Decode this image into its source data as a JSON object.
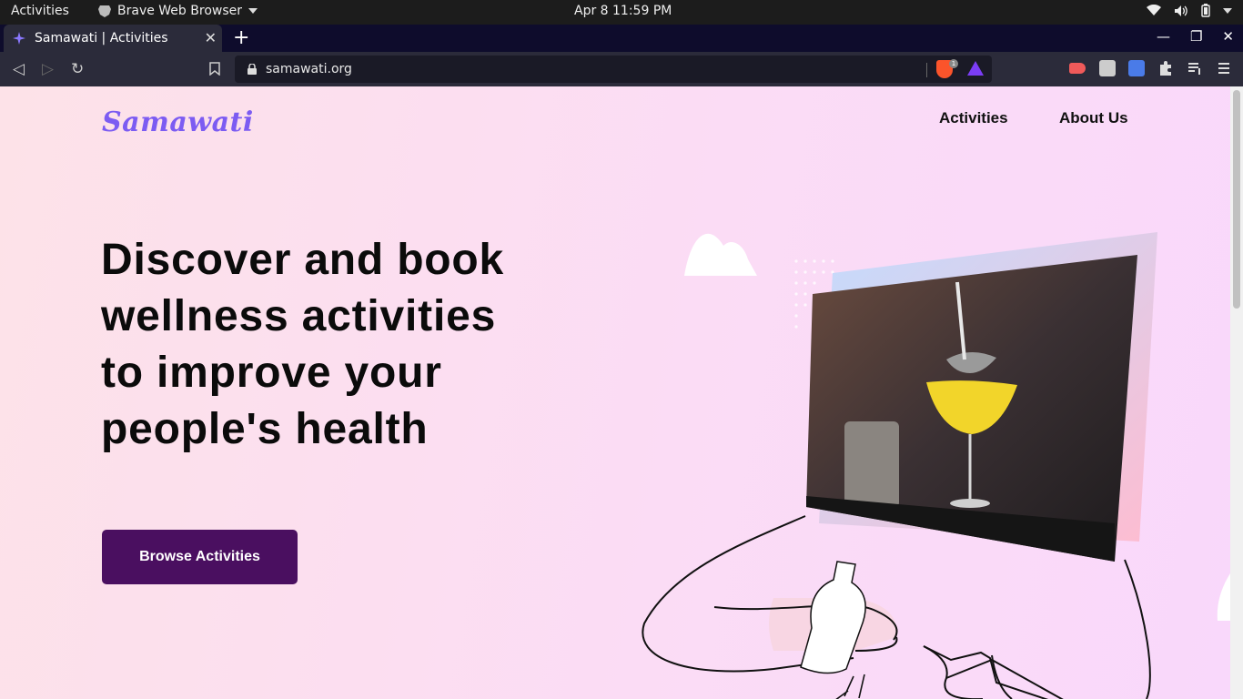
{
  "system_bar": {
    "activities": "Activities",
    "app_name": "Brave Web Browser",
    "clock": "Apr 8  11:59 PM"
  },
  "browser": {
    "tab_title": "Samawati | Activities",
    "url": "samawati.org",
    "shields_count": "1"
  },
  "page": {
    "logo": "Samawati",
    "nav": [
      "Activities",
      "About Us"
    ],
    "headline": [
      "Discover and book",
      "wellness activities",
      "to improve your",
      "people's health"
    ],
    "cta_label": "Browse Activities"
  },
  "colors": {
    "brand_logo": "#7c5cf2",
    "cta_bg": "#4a0f60",
    "page_bg_start": "#fde2e8",
    "page_bg_end": "#f9d8fb"
  }
}
